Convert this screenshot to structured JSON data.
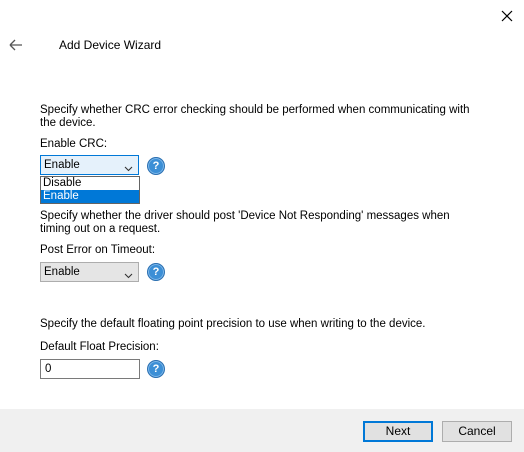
{
  "window": {
    "title": "Add Device Wizard",
    "close_icon": "close-icon",
    "back_icon": "back-arrow-icon"
  },
  "crc": {
    "description": "Specify whether CRC error checking should be performed when communicating with the device.",
    "label": "Enable CRC:",
    "selected": "Enable",
    "options": [
      "Disable",
      "Enable"
    ],
    "help": "?"
  },
  "timeout": {
    "description": "Specify whether the driver should post 'Device Not Responding' messages when timing out on a request.",
    "label": "Post Error on Timeout:",
    "selected": "Enable",
    "help": "?"
  },
  "precision": {
    "description": "Specify the default floating point precision to use when writing to the device.",
    "label": "Default Float Precision:",
    "value": "0",
    "help": "?"
  },
  "footer": {
    "next_label": "Next",
    "cancel_label": "Cancel"
  },
  "colors": {
    "accent": "#0078d7",
    "help_icon": "#3c8fd6",
    "footer_bg": "#f0f0f0"
  }
}
